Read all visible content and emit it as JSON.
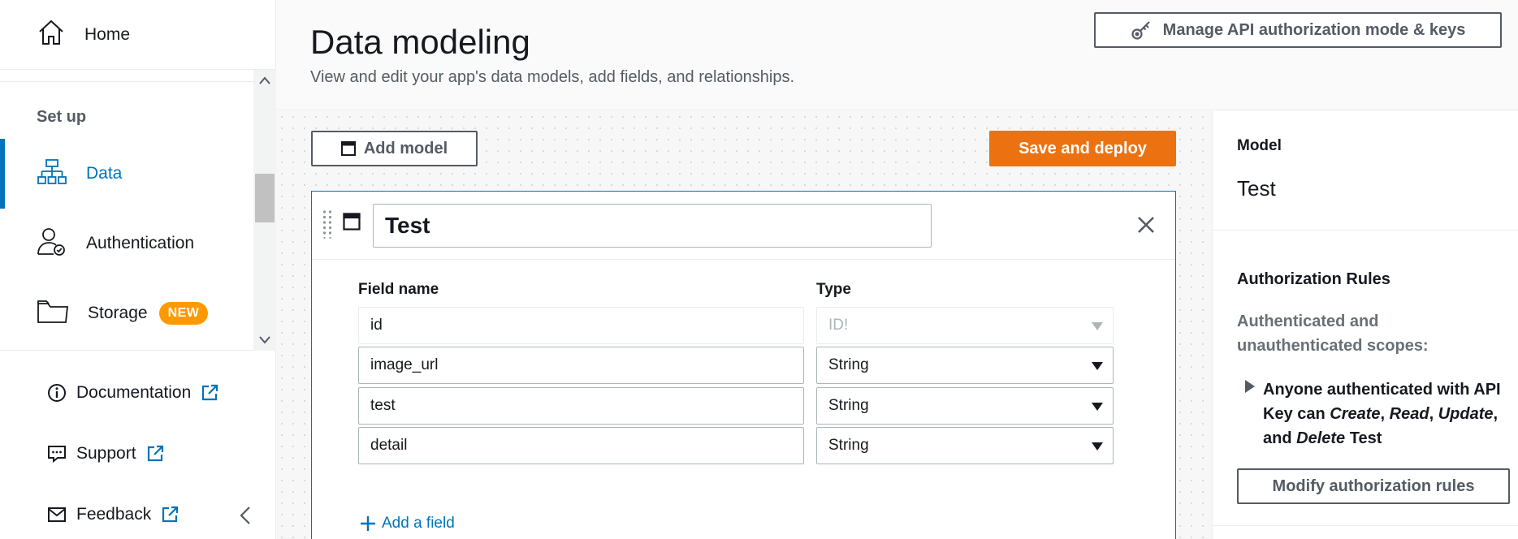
{
  "sidebar": {
    "home_label": "Home",
    "section_label": "Set up",
    "items": [
      {
        "label": "Data",
        "active": true
      },
      {
        "label": "Authentication"
      },
      {
        "label": "Storage",
        "badge": "NEW"
      }
    ],
    "links": [
      {
        "label": "Documentation"
      },
      {
        "label": "Support"
      },
      {
        "label": "Feedback"
      }
    ]
  },
  "header": {
    "title": "Data modeling",
    "subtitle": "View and edit your app's data models, add fields, and relationships.",
    "manage_label": "Manage API authorization mode & keys"
  },
  "toolbar": {
    "add_model_label": "Add model",
    "save_deploy_label": "Save and deploy"
  },
  "model": {
    "name": "Test",
    "col_field": "Field name",
    "col_type": "Type",
    "fields": [
      {
        "name": "id",
        "type": "ID!",
        "disabled": true
      },
      {
        "name": "image_url",
        "type": "String"
      },
      {
        "name": "test",
        "type": "String"
      },
      {
        "name": "detail",
        "type": "String"
      }
    ],
    "add_field_label": "Add a field"
  },
  "panel": {
    "model_heading": "Model",
    "model_value": "Test",
    "auth_heading": "Authorization Rules",
    "scope_text": "Authenticated and unauthenticated scopes:",
    "rule": {
      "prefix": "Anyone authenticated with API Key can ",
      "op1": "Create",
      "sep1": ", ",
      "op2": "Read",
      "sep2": ", ",
      "op3": "Update",
      "sep3": ", and ",
      "op4": "Delete",
      "suffix": " Test"
    },
    "modify_label": "Modify authorization rules"
  },
  "colors": {
    "accent": "#0073bb",
    "primary_button": "#ec7211",
    "badge": "#ff9900",
    "text_secondary": "#545b64"
  }
}
